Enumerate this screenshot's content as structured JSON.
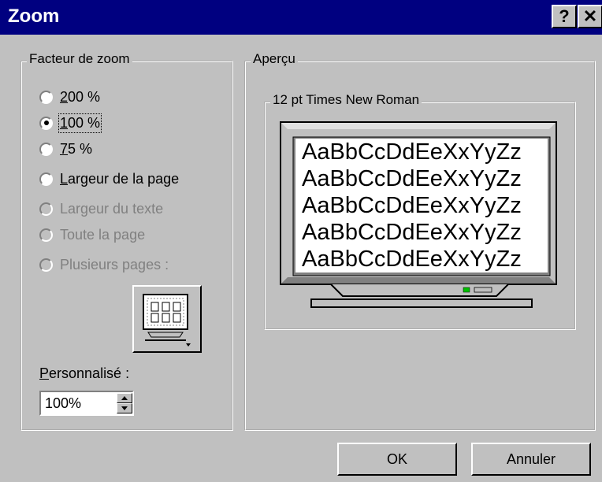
{
  "window": {
    "title": "Zoom",
    "help_label": "?",
    "close_label": "✕"
  },
  "zoom_factor": {
    "legend": "Facteur de zoom",
    "options": [
      {
        "label": "200 %",
        "accel": "2",
        "rest": "00 %",
        "selected": false,
        "enabled": true
      },
      {
        "label": "100 %",
        "accel": "1",
        "rest": "00 %",
        "selected": true,
        "enabled": true
      },
      {
        "label": "75 %",
        "accel": "7",
        "rest": "5 %",
        "selected": false,
        "enabled": true
      },
      {
        "label": "Largeur de la page",
        "accel": "L",
        "rest": "argeur de la page",
        "selected": false,
        "enabled": true
      },
      {
        "label": "Largeur du texte",
        "selected": false,
        "enabled": false
      },
      {
        "label": "Toute la page",
        "selected": false,
        "enabled": false
      },
      {
        "label": "Plusieurs pages :",
        "selected": false,
        "enabled": false
      }
    ],
    "multipage_button_icon": "monitor-pages-icon",
    "custom": {
      "label": "Personnalisé :",
      "accel": "P",
      "rest": "ersonnalisé :",
      "value": "100%"
    }
  },
  "preview": {
    "legend": "Aperçu",
    "font_legend": "12 pt Times New Roman",
    "sample_lines": [
      "AaBbCcDdEeXxYyZz",
      "AaBbCcDdEeXxYyZz",
      "AaBbCcDdEeXxYyZz",
      "AaBbCcDdEeXxYyZz",
      "AaBbCcDdEeXxYyZz"
    ]
  },
  "buttons": {
    "ok": "OK",
    "cancel": "Annuler"
  },
  "colors": {
    "titlebar": "#000080",
    "face": "#c0c0c0",
    "disabled_text": "#808080"
  }
}
